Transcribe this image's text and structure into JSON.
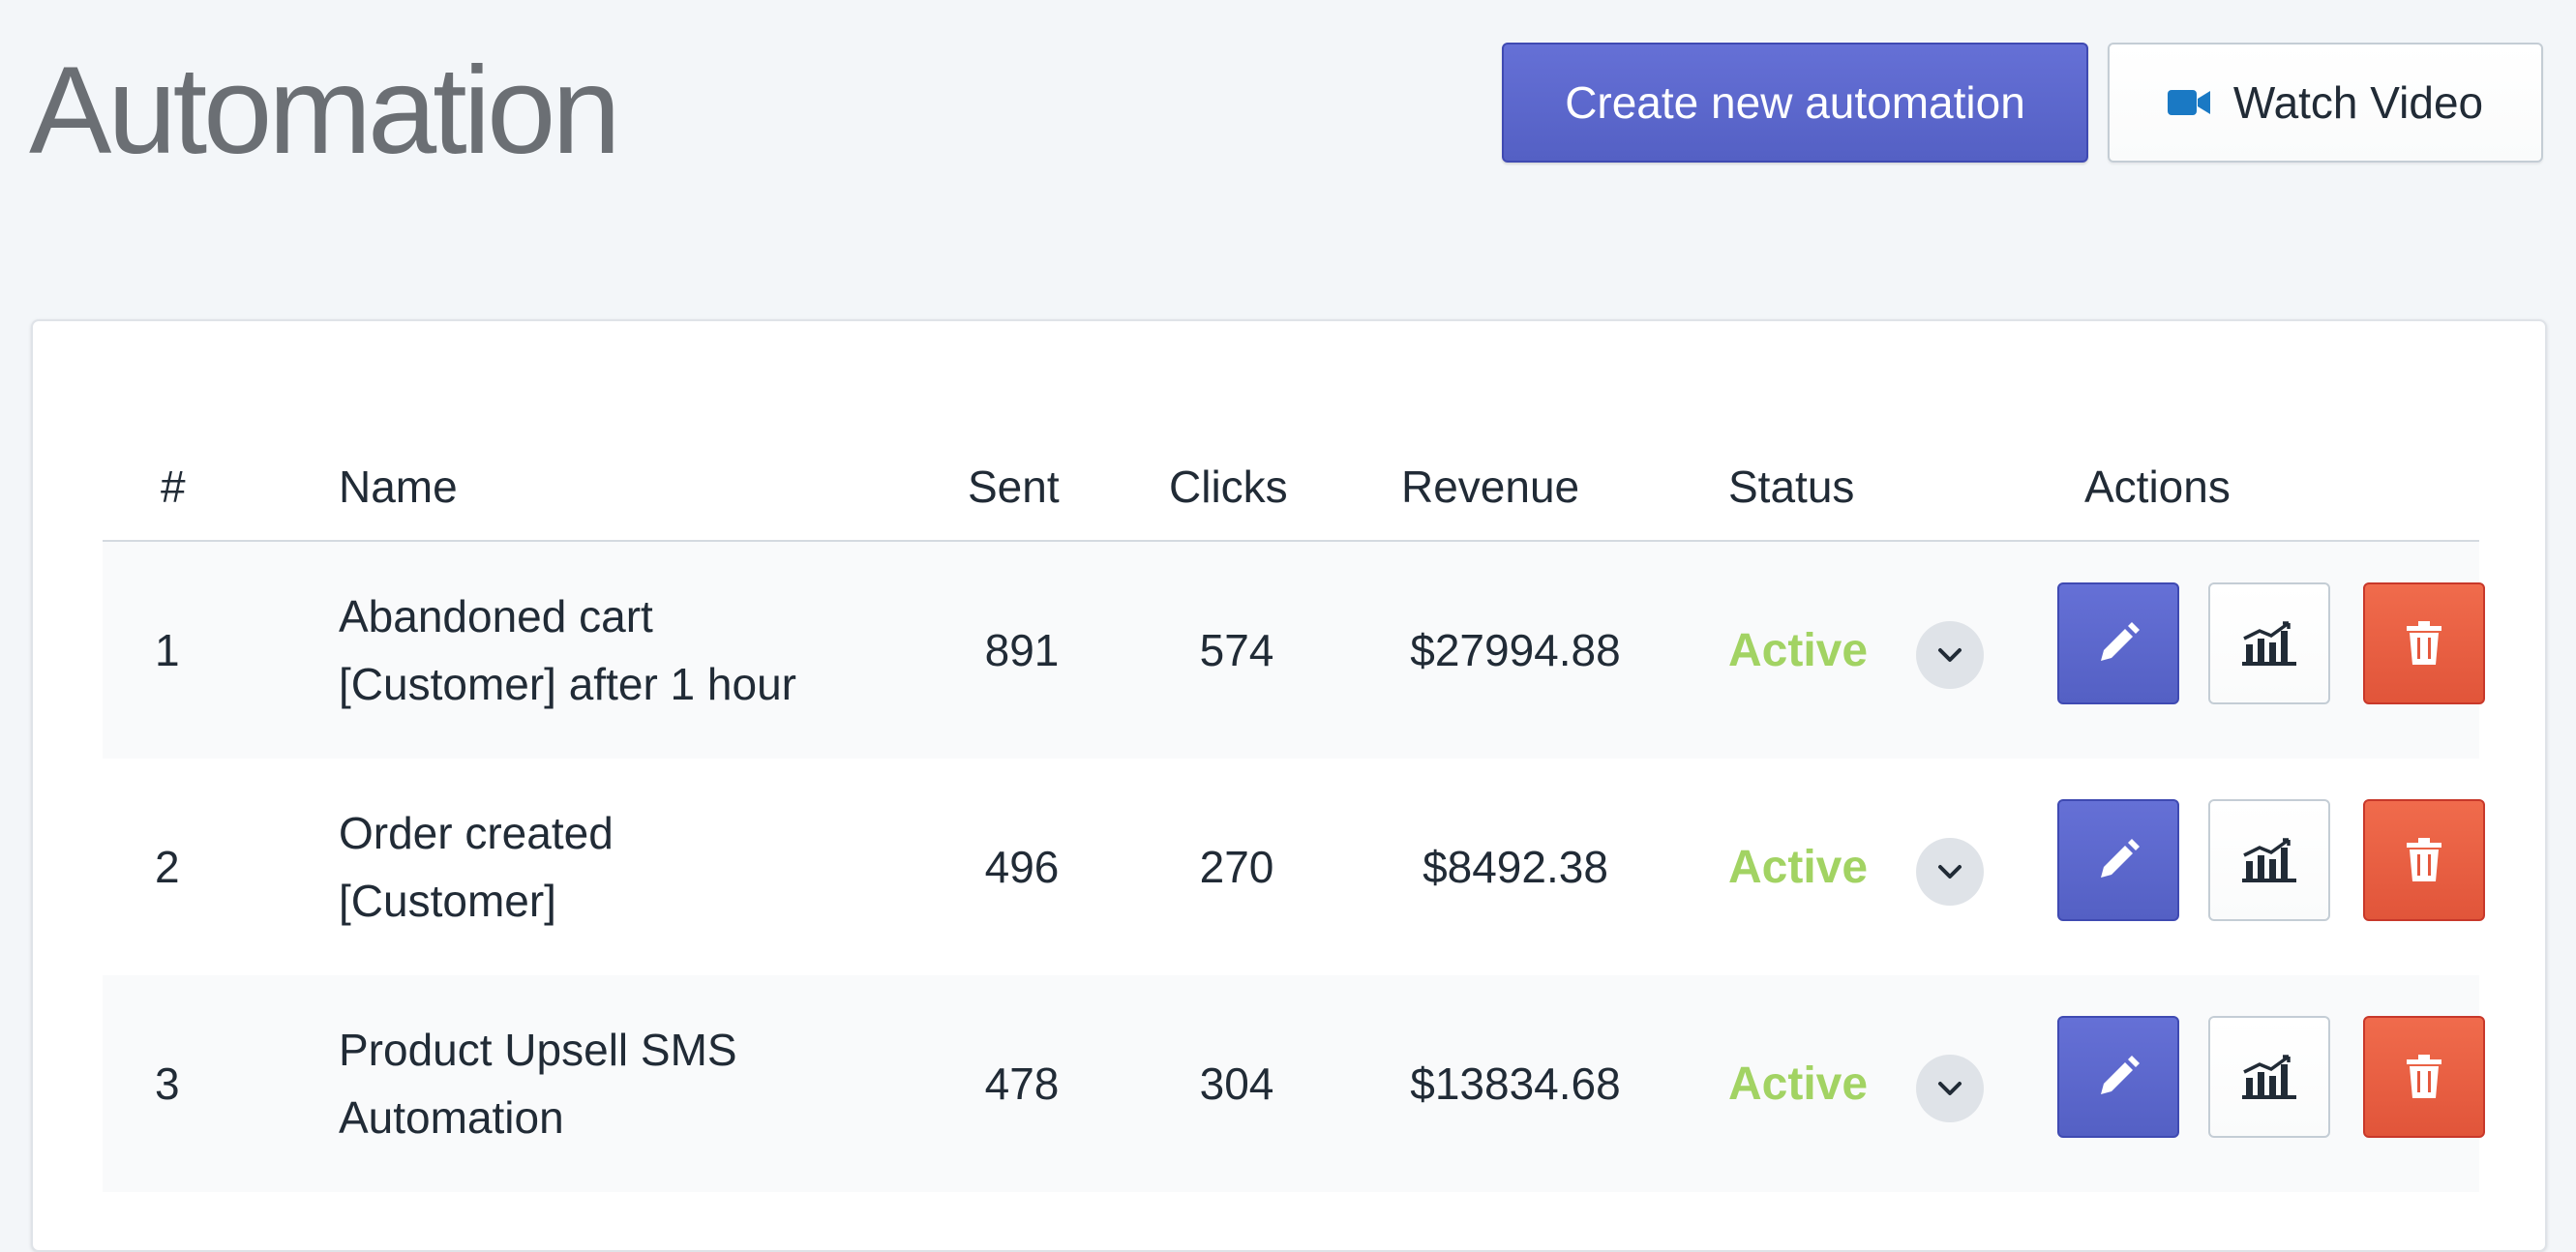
{
  "header": {
    "title": "Automation",
    "create_label": "Create new automation",
    "video_label": "Watch Video",
    "video_icon": "video-camera-icon"
  },
  "table": {
    "columns": [
      "#",
      "Name",
      "Sent",
      "Clicks",
      "Revenue",
      "Status",
      "Actions"
    ],
    "rows": [
      {
        "num": "1",
        "name": "Abandoned cart [Customer] after 1 hour",
        "sent": "891",
        "clicks": "574",
        "revenue": "$27994.88",
        "status": "Active"
      },
      {
        "num": "2",
        "name": "Order created [Customer]",
        "sent": "496",
        "clicks": "270",
        "revenue": "$8492.38",
        "status": "Active"
      },
      {
        "num": "3",
        "name": "Product Upsell SMS Automation",
        "sent": "478",
        "clicks": "304",
        "revenue": "$13834.68",
        "status": "Active"
      }
    ],
    "action_icons": [
      "pencil-icon",
      "chart-icon",
      "trash-icon"
    ]
  },
  "colors": {
    "primary": "#5c6ac4",
    "danger": "#e5573d",
    "active_status": "#a2d363",
    "background": "#f3f6f9"
  }
}
